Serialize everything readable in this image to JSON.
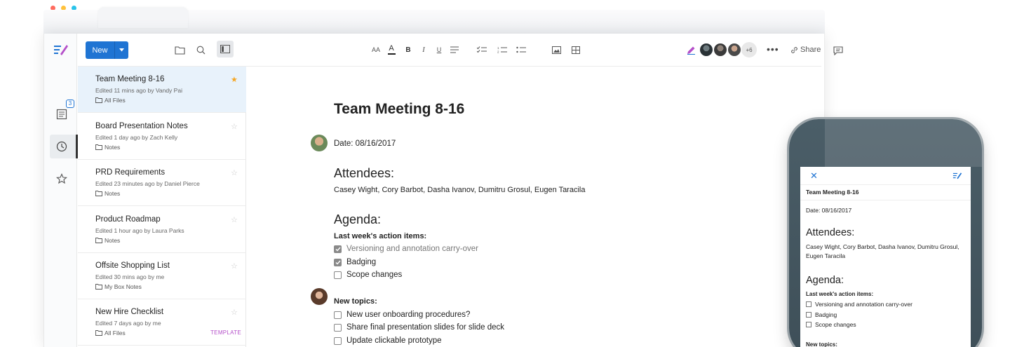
{
  "colors": {
    "accent": "#1f74d3",
    "star": "#f5a623",
    "template": "#b44fc9"
  },
  "nav": {
    "badge_count": "3"
  },
  "toolbar": {
    "new_label": "New",
    "font_size_label": "AA",
    "text_color_label": "A",
    "bold_label": "B",
    "italic_label": "I",
    "underline_label": "U",
    "more_collaborators": "+6",
    "more_label": "•••",
    "share_label": "Share"
  },
  "files": [
    {
      "name": "Team Meeting 8-16",
      "meta": "Edited 11 mins ago by Vandy Pai",
      "location": "All Files",
      "starred": true,
      "template": ""
    },
    {
      "name": "Board Presentation Notes",
      "meta": "Edited 1 day ago by Zach Kelly",
      "location": "Notes",
      "starred": false,
      "template": ""
    },
    {
      "name": "PRD Requirements",
      "meta": "Edited 23 minutes ago by Daniel Pierce",
      "location": "Notes",
      "starred": false,
      "template": ""
    },
    {
      "name": "Product Roadmap",
      "meta": "Edited 1 hour ago by Laura Parks",
      "location": "Notes",
      "starred": false,
      "template": ""
    },
    {
      "name": "Offsite Shopping List",
      "meta": "Edited 30 mins ago by me",
      "location": "My Box Notes",
      "starred": false,
      "template": ""
    },
    {
      "name": "New Hire Checklist",
      "meta": "Edited 7 days ago by me",
      "location": "All Files",
      "starred": false,
      "template": "TEMPLATE"
    }
  ],
  "doc": {
    "title": "Team Meeting 8-16",
    "date": "Date: 08/16/2017",
    "attendees_heading": "Attendees:",
    "attendees": "Casey Wight, Cory Barbot, Dasha Ivanov, Dumitru Grosul, Eugen Taracila",
    "agenda_heading": "Agenda:",
    "last_week_label": "Last week's action items:",
    "last_week_items": [
      {
        "text": "Versioning and annotation carry-over",
        "checked": true
      },
      {
        "text": "Badging",
        "checked": true
      },
      {
        "text": "Scope changes",
        "checked": false
      }
    ],
    "new_topics_label": "New topics:",
    "new_topics_items": [
      {
        "text": "New user onboarding procedures?",
        "checked": false
      },
      {
        "text": "Share final presentation slides for slide deck",
        "checked": false
      },
      {
        "text": "Update clickable prototype",
        "checked": false
      }
    ]
  },
  "phone": {
    "close_label": "✕",
    "title": "Team Meeting 8-16",
    "date": "Date: 08/16/2017",
    "attendees_heading": "Attendees:",
    "attendees": "Casey Wight, Cory Barbot, Dasha Ivanov, Dumitru Grosul, Eugen Taracila",
    "agenda_heading": "Agenda:",
    "last_week_label": "Last week's action items:",
    "items": [
      "Versioning and annotation carry-over",
      "Badging",
      "Scope changes"
    ],
    "new_topics_label": "New topics:"
  }
}
